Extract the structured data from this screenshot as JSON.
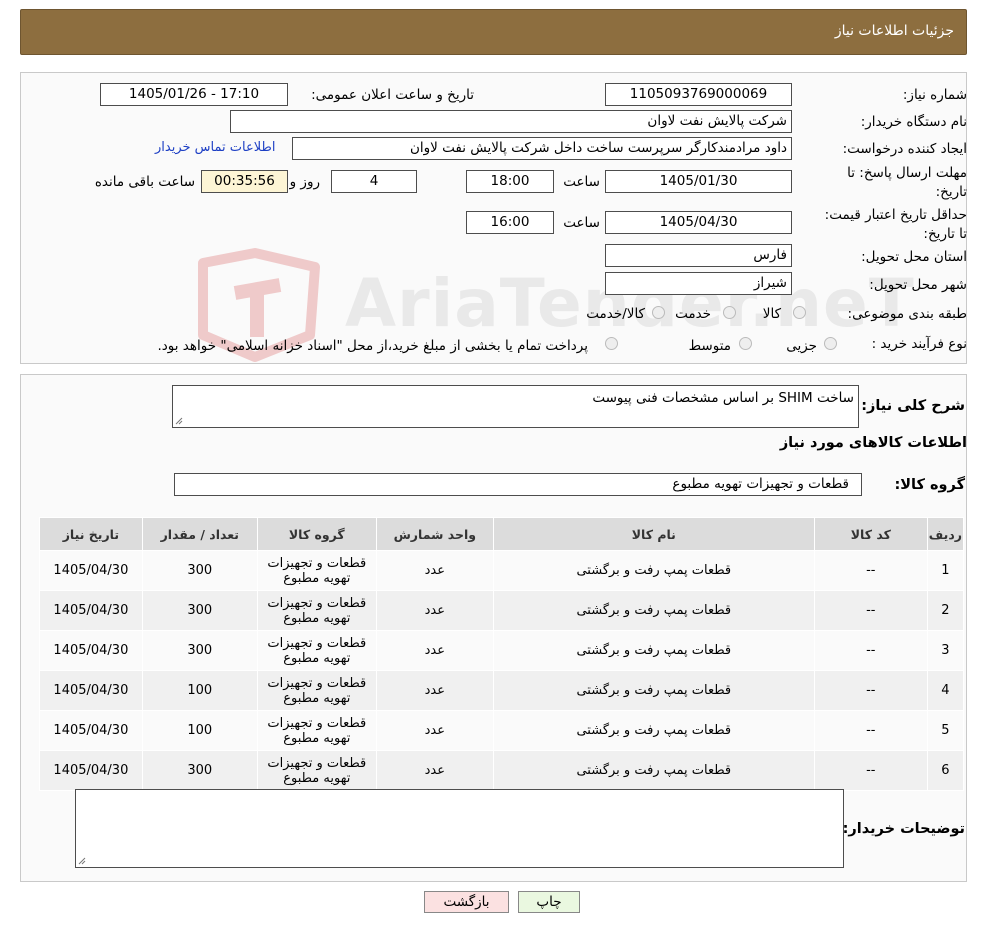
{
  "header": {
    "title": "جزئیات اطلاعات نیاز"
  },
  "form": {
    "need_number_label": "شماره نیاز:",
    "need_number": "1105093769000069",
    "announce_label": "تاریخ و ساعت اعلان عمومی:",
    "announce_value": "1405/01/26 - 17:10",
    "buyer_org_label": "نام دستگاه خریدار:",
    "buyer_org": "شرکت پالایش نفت لاوان",
    "creator_label": "ایجاد کننده درخواست:",
    "creator": "داود مرادمندکارگر سرپرست ساخت داخل شرکت پالایش نفت لاوان",
    "contact_link": "اطلاعات تماس خریدار",
    "deadline_label": "مهلت ارسال پاسخ: تا تاریخ:",
    "deadline_date": "1405/01/30",
    "time_label": "ساعت",
    "deadline_time": "18:00",
    "days": "4",
    "days_label": "روز و",
    "remaining": "00:35:56",
    "remaining_label": "ساعت باقی مانده",
    "validity_label": "حداقل تاریخ اعتبار قیمت: تا تاریخ:",
    "validity_date": "1405/04/30",
    "validity_time": "16:00",
    "province_label": "استان محل تحویل:",
    "province": "فارس",
    "city_label": "شهر محل تحویل:",
    "city": "شیراز",
    "category_label": "طبقه بندی موضوعی:",
    "cat_goods": "کالا",
    "cat_service": "خدمت",
    "cat_both": "کالا/خدمت",
    "process_label": "نوع فرآیند خرید :",
    "proc_partial": "جزیی",
    "proc_medium": "متوسط",
    "proc_note": "پرداخت تمام یا بخشی از مبلغ خرید،از محل \"اسناد خزانه اسلامی\" خواهد بود."
  },
  "details": {
    "desc_label": "شرح کلی نیاز:",
    "desc": "ساخت SHIM بر اساس مشخصات فنی پیوست",
    "goods_info_title": "اطلاعات کالاهای مورد نیاز",
    "group_label": "گروه کالا:",
    "group_value": "قطعات و تجهیزات تهویه مطبوع",
    "buyer_notes_label": "توضیحات خریدار:"
  },
  "table": {
    "headers": [
      "ردیف",
      "کد کالا",
      "نام کالا",
      "واحد شمارش",
      "گروه کالا",
      "تعداد / مقدار",
      "تاریخ نیاز"
    ],
    "rows": [
      [
        "1",
        "--",
        "قطعات پمپ رفت و برگشتی",
        "عدد",
        "قطعات و تجهیزات تهویه مطبوع",
        "300",
        "1405/04/30"
      ],
      [
        "2",
        "--",
        "قطعات پمپ رفت و برگشتی",
        "عدد",
        "قطعات و تجهیزات تهویه مطبوع",
        "300",
        "1405/04/30"
      ],
      [
        "3",
        "--",
        "قطعات پمپ رفت و برگشتی",
        "عدد",
        "قطعات و تجهیزات تهویه مطبوع",
        "300",
        "1405/04/30"
      ],
      [
        "4",
        "--",
        "قطعات پمپ رفت و برگشتی",
        "عدد",
        "قطعات و تجهیزات تهویه مطبوع",
        "100",
        "1405/04/30"
      ],
      [
        "5",
        "--",
        "قطعات پمپ رفت و برگشتی",
        "عدد",
        "قطعات و تجهیزات تهویه مطبوع",
        "100",
        "1405/04/30"
      ],
      [
        "6",
        "--",
        "قطعات پمپ رفت و برگشتی",
        "عدد",
        "قطعات و تجهیزات تهویه مطبوع",
        "300",
        "1405/04/30"
      ]
    ]
  },
  "buttons": {
    "print": "چاپ",
    "back": "بازگشت"
  },
  "watermark": {
    "text": "AriaTender.neT"
  },
  "colors": {
    "header_bg": "#8d6e3f",
    "link": "#1d3fc4",
    "remaining_bg": "#fdf5d5",
    "back_bg": "#fbe1e1",
    "print_bg": "#eaf8e0"
  }
}
